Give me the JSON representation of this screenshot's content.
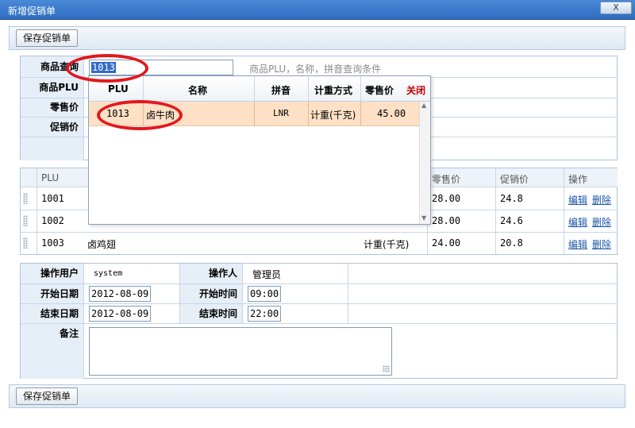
{
  "window": {
    "title": "新增促销单",
    "close_label": "X"
  },
  "toolbar": {
    "save_label": "保存促销单"
  },
  "query": {
    "label": "商品查询",
    "value": "1013",
    "hint": "商品PLU，名称，拼音查询条件"
  },
  "fields": {
    "plu_label": "商品PLU",
    "retail_label": "零售价",
    "promo_label": "促销价"
  },
  "dropdown": {
    "headers": [
      "PLU",
      "名称",
      "拼音",
      "计重方式",
      "零售价"
    ],
    "close_label": "关闭",
    "rows": [
      {
        "plu": "1013",
        "name": "卤牛肉",
        "pinyin": "LNR",
        "weigh": "计重(千克)",
        "price": "45.00"
      }
    ]
  },
  "grid": {
    "headers": {
      "plu": "PLU",
      "retail": "零售价",
      "promo": "促销价",
      "action": "操作"
    },
    "rows": [
      {
        "plu": "1001",
        "name": "",
        "weigh": "",
        "retail": "28.00",
        "promo": "24.8",
        "edit": "编辑",
        "delete": "删除"
      },
      {
        "plu": "1002",
        "name": "",
        "weigh": "",
        "retail": "28.00",
        "promo": "24.6",
        "edit": "编辑",
        "delete": "删除"
      },
      {
        "plu": "1003",
        "name": "卤鸡翅",
        "weigh": "计重(千克)",
        "retail": "24.00",
        "promo": "20.8",
        "edit": "编辑",
        "delete": "删除"
      }
    ]
  },
  "info": {
    "user_label": "操作用户",
    "user_value": "system",
    "operator_label": "操作人",
    "operator_value": "管理员",
    "start_date_label": "开始日期",
    "start_date": "2012-08-09",
    "start_time_label": "开始时间",
    "start_time": "09:00",
    "end_date_label": "结束日期",
    "end_date": "2012-08-09",
    "end_time_label": "结束时间",
    "end_time": "22:00",
    "remark_label": "备注",
    "remark_value": ""
  },
  "colors": {
    "title_bar": "#2e6cc0",
    "highlight_row": "#fde0c5",
    "annotation_ring": "#e3171d",
    "close_text": "#c00000"
  }
}
